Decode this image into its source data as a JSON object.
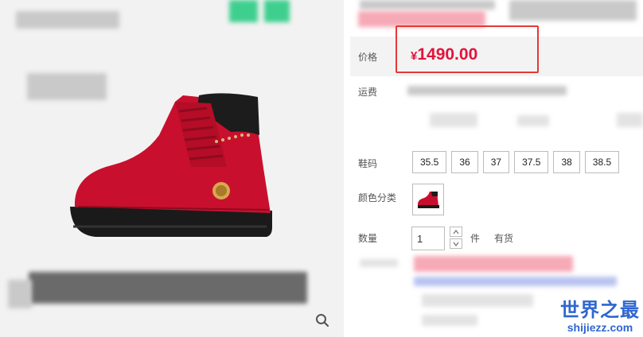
{
  "product": {
    "price_label": "价格",
    "currency_symbol": "¥",
    "price": "1490.00",
    "shipping_label": "运费",
    "size_label": "鞋码",
    "sizes": [
      "35.5",
      "36",
      "37",
      "37.5",
      "38",
      "38.5"
    ],
    "color_label": "颜色分类",
    "quantity_label": "数量",
    "quantity_value": "1",
    "quantity_unit": "件",
    "stock_status": "有货"
  },
  "gallery": {
    "main_image_icon": "red-boot-image",
    "zoom_icon": "search-icon"
  },
  "watermark": {
    "title": "世界之最",
    "url": "shijiezz.com"
  },
  "colors": {
    "price": "#e4133b",
    "highlight_border": "#e53935",
    "boot_red": "#c8102e",
    "watermark_blue": "#2f66d0"
  }
}
